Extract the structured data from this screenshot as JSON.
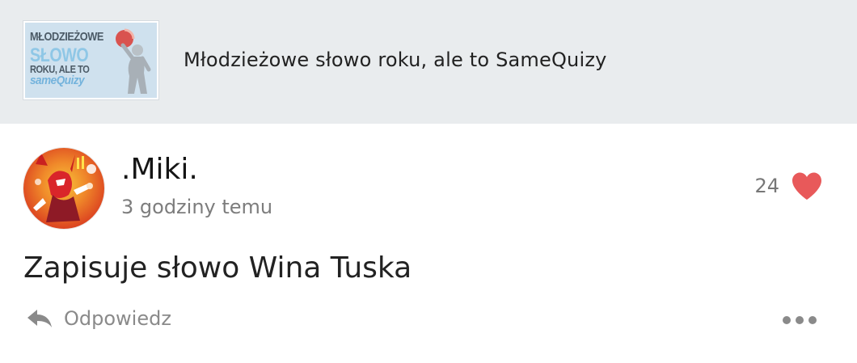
{
  "quiz": {
    "thumbnail_text": {
      "line1": "MŁODZIEŻOWE",
      "line2": "SŁOWO",
      "line3": "ROKU, ALE TO",
      "line4": "sameQuizy"
    },
    "title": "Młodzieżowe słowo roku, ale to SameQuizy"
  },
  "comment": {
    "username": ".Miki.",
    "timestamp": "3 godziny temu",
    "likes": "24",
    "text": "Zapisuje słowo Wina Tuska",
    "reply_label": "Odpowiedz"
  },
  "icons": {
    "like": "heart-icon",
    "reply": "reply-arrow-icon",
    "more": "more-options-icon"
  },
  "colors": {
    "header_bg": "#e9ecee",
    "heart": "#e8595a",
    "muted_text": "#7d7d7d"
  }
}
